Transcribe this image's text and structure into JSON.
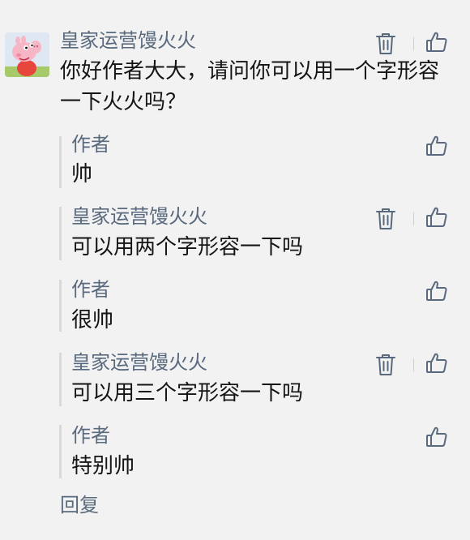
{
  "comment": {
    "author": "皇家运营馒火火",
    "text": "你好作者大大，请问你可以用一个字形容一下火火吗？"
  },
  "replies": [
    {
      "author": "作者",
      "text": "帅"
    },
    {
      "author": "皇家运营馒火火",
      "text": "可以用两个字形容一下吗"
    },
    {
      "author": "作者",
      "text": "很帅"
    },
    {
      "author": "皇家运营馒火火",
      "text": "可以用三个字形容一下吗"
    },
    {
      "author": "作者",
      "text": "特别帅"
    }
  ],
  "actions": {
    "reply_label": "回复"
  },
  "colors": {
    "background": "#f2f2f2",
    "name": "#5a6a7e",
    "text": "#151515",
    "icon": "#5a6a7e",
    "thread_bar": "#d9d9d9"
  }
}
